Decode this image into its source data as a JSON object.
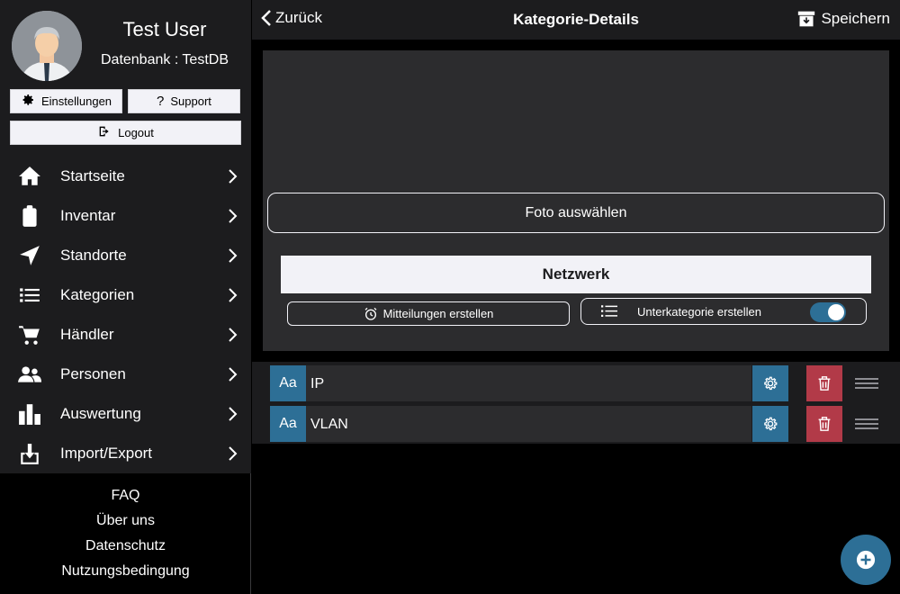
{
  "sidebar": {
    "user_name": "Test User",
    "database": "Datenbank : TestDB",
    "settings_label": "Einstellungen",
    "support_label": "Support",
    "logout_label": "Logout",
    "nav": [
      {
        "label": "Startseite",
        "icon": "home-icon"
      },
      {
        "label": "Inventar",
        "icon": "clipboard-icon"
      },
      {
        "label": "Standorte",
        "icon": "location-arrow-icon"
      },
      {
        "label": "Kategorien",
        "icon": "list-icon"
      },
      {
        "label": "Händler",
        "icon": "cart-icon"
      },
      {
        "label": "Personen",
        "icon": "people-icon"
      },
      {
        "label": "Auswertung",
        "icon": "bar-chart-icon"
      },
      {
        "label": "Import/Export",
        "icon": "download-icon"
      }
    ],
    "footer": [
      "FAQ",
      "Über uns",
      "Datenschutz",
      "Nutzungsbedingung"
    ]
  },
  "header": {
    "back_label": "Zurück",
    "title": "Kategorie-Details",
    "save_label": "Speichern"
  },
  "category": {
    "photo_button": "Foto auswählen",
    "name": "Netzwerk",
    "messages_button": "Mitteilungen erstellen",
    "subcategory_label": "Unterkategorie erstellen",
    "subcategory_enabled": true
  },
  "fields": [
    {
      "type_label": "Aa",
      "name": "IP"
    },
    {
      "type_label": "Aa",
      "name": "VLAN"
    }
  ],
  "colors": {
    "accent": "#2d6f96",
    "danger": "#b23a48",
    "panel": "#2c2c2e"
  }
}
